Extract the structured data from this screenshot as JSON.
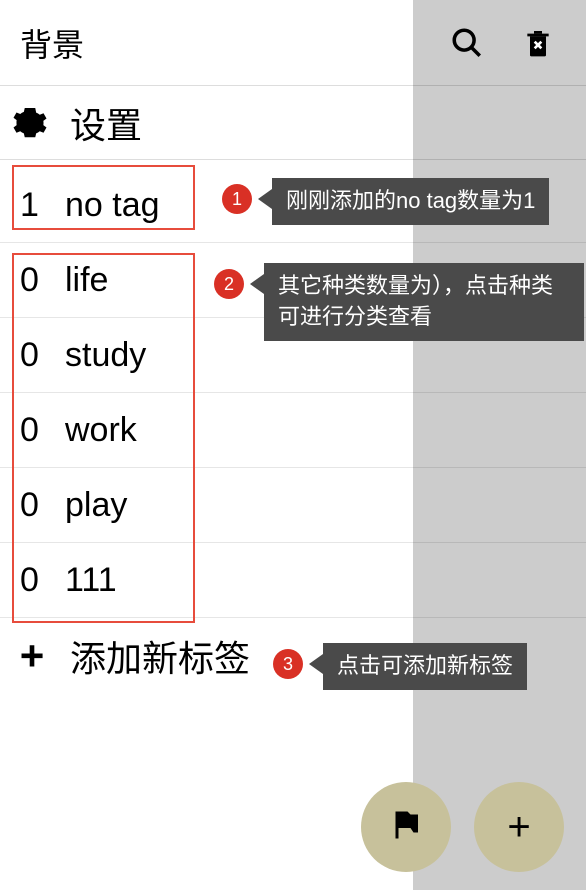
{
  "header": {
    "title": "背景",
    "icons": {
      "search": "search-icon",
      "delete": "delete-icon"
    }
  },
  "settings": {
    "label": "设置"
  },
  "tags": [
    {
      "count": "1",
      "name": "no tag"
    },
    {
      "count": "0",
      "name": "life"
    },
    {
      "count": "0",
      "name": "study"
    },
    {
      "count": "0",
      "name": "work"
    },
    {
      "count": "0",
      "name": "play"
    },
    {
      "count": "0",
      "name": "111"
    }
  ],
  "add_tag": {
    "label": "添加新标签"
  },
  "callouts": [
    {
      "num": "1",
      "text": "刚刚添加的no tag数量为1"
    },
    {
      "num": "2",
      "text": "其它种类数量为），点击种类可进行分类查看"
    },
    {
      "num": "3",
      "text": "点击可添加新标签"
    }
  ]
}
